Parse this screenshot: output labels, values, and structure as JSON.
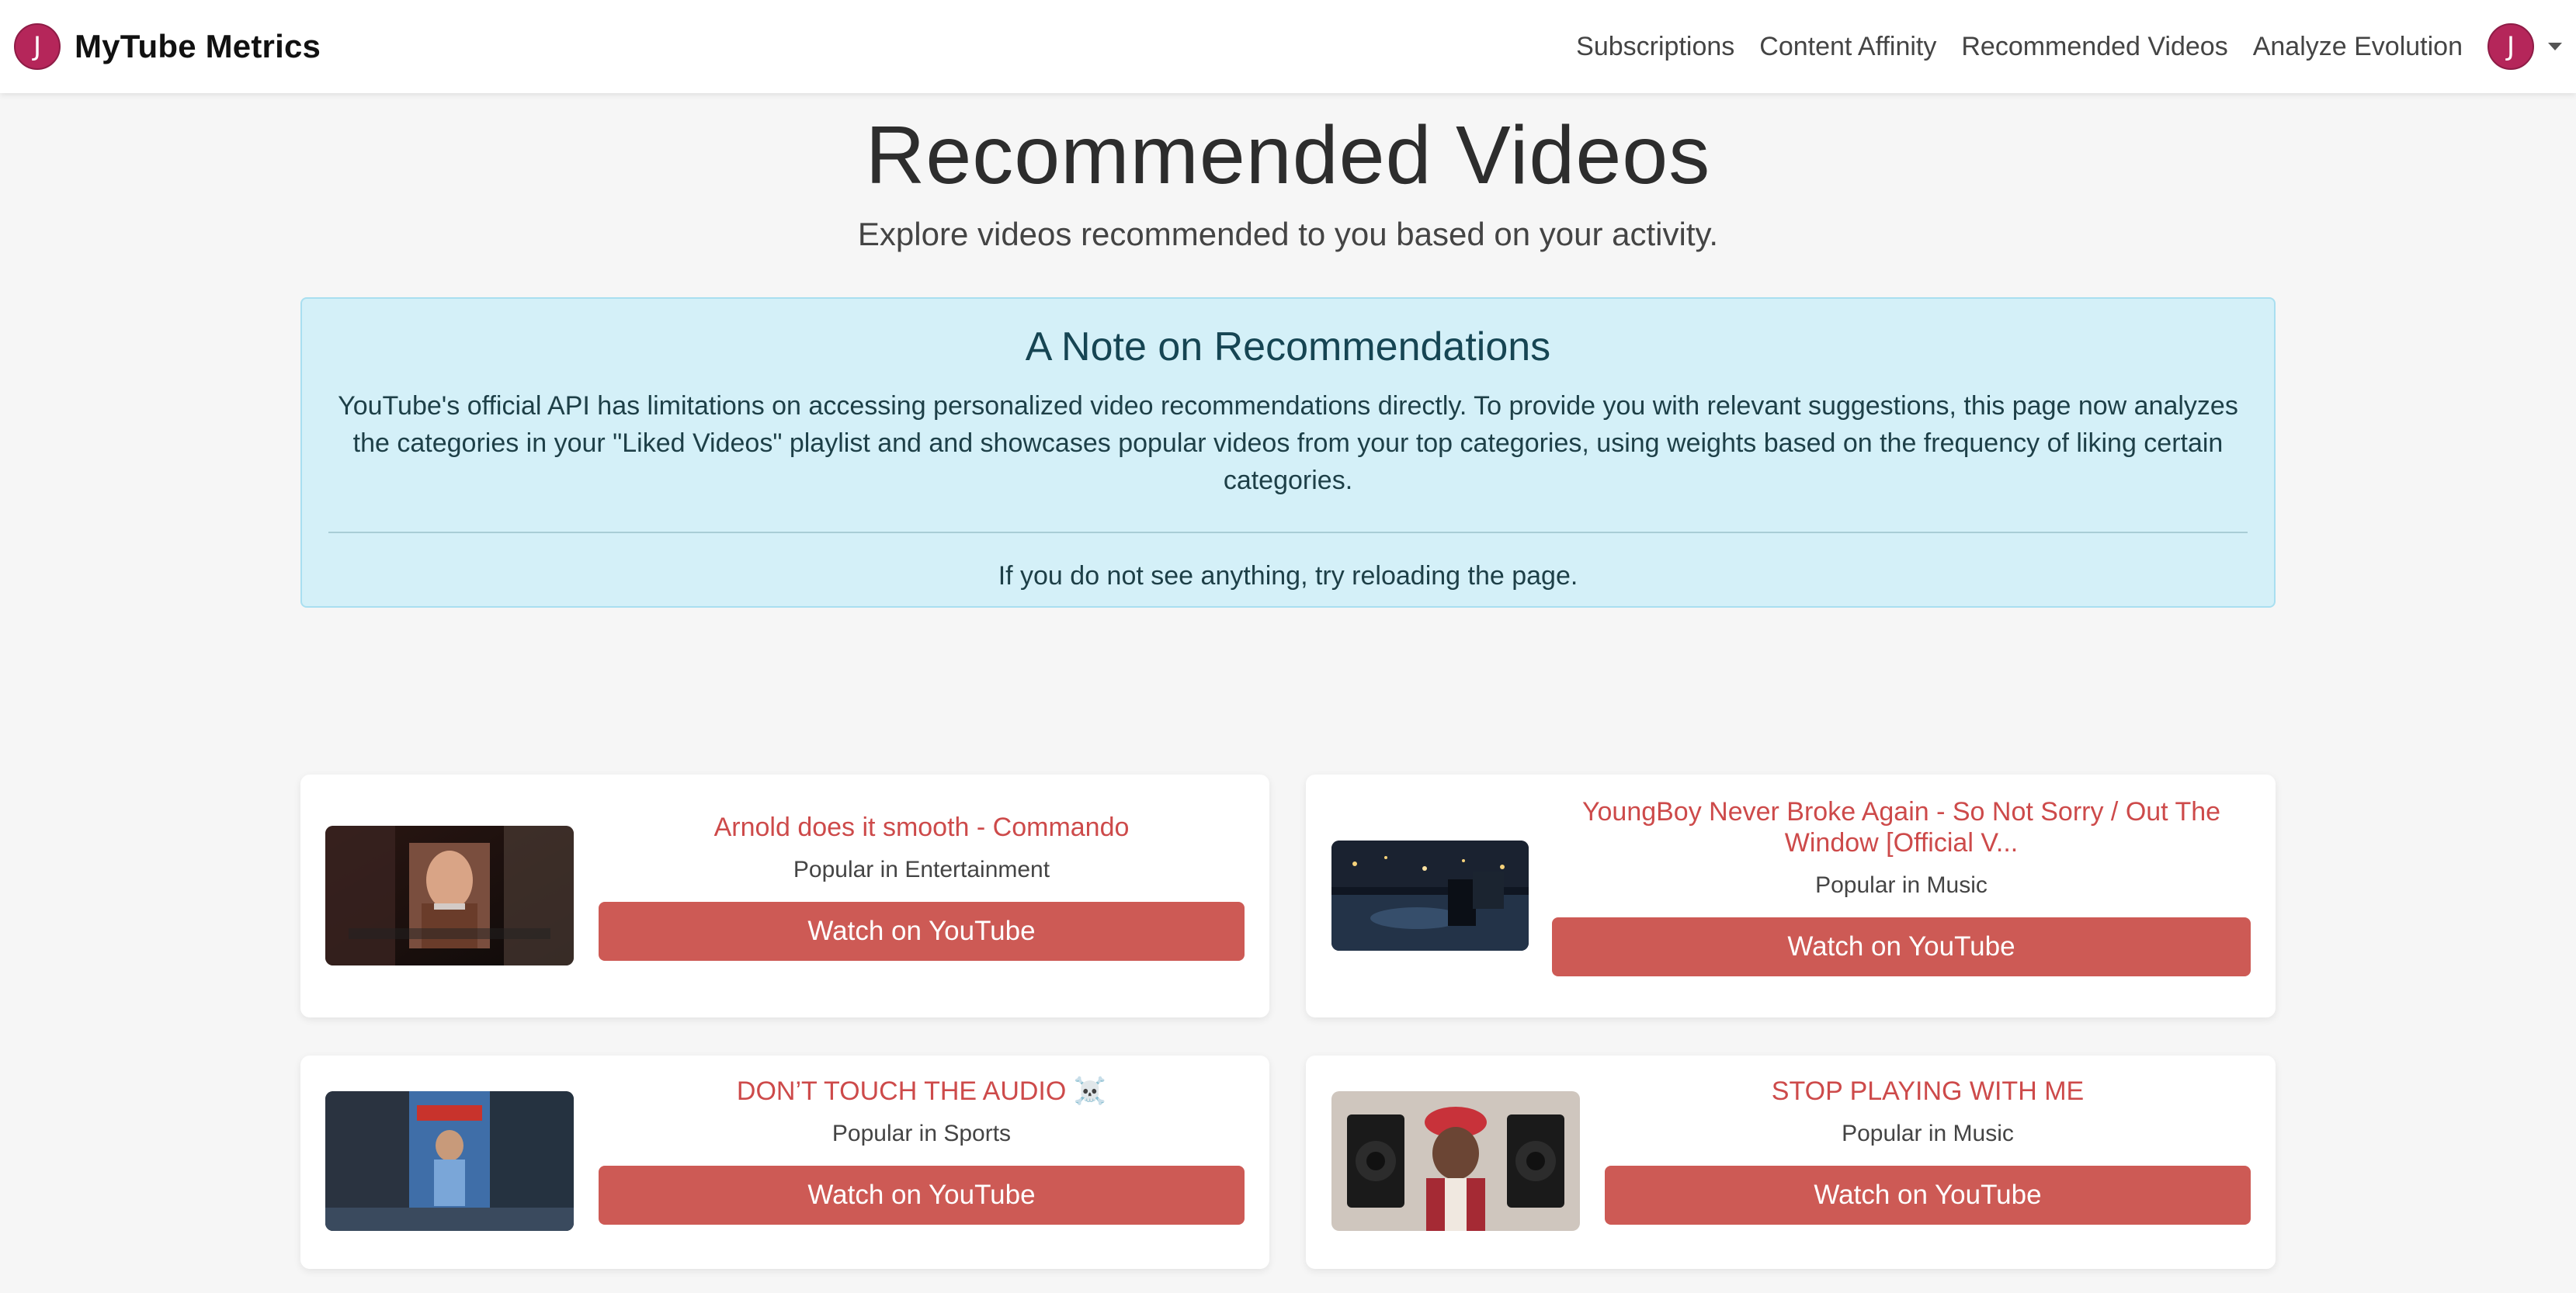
{
  "brand": {
    "avatar_letter": "J",
    "name": "MyTube Metrics"
  },
  "nav": {
    "links": [
      "Subscriptions",
      "Content Affinity",
      "Recommended Videos",
      "Analyze Evolution"
    ],
    "user_avatar_letter": "J"
  },
  "page": {
    "title": "Recommended Videos",
    "subtitle": "Explore videos recommended to you based on your activity."
  },
  "note": {
    "title": "A Note on Recommendations",
    "body": "YouTube's official API has limitations on accessing personalized video recommendations directly. To provide you with relevant suggestions, this page now analyzes the categories in your \"Liked Videos\" playlist and and showcases popular videos from your top categories, using weights based on the frequency of liking certain categories.",
    "footer": "If you do not see anything, try reloading the page."
  },
  "videos": [
    {
      "title": "Arnold does it smooth - Commando",
      "category": "Popular in Entertainment",
      "button": "Watch on YouTube"
    },
    {
      "title": "YoungBoy Never Broke Again - So Not Sorry / Out The Window [Official V...",
      "category": "Popular in Music",
      "button": "Watch on YouTube"
    },
    {
      "title": "DON’T TOUCH THE AUDIO ☠️",
      "category": "Popular in Sports",
      "button": "Watch on YouTube"
    },
    {
      "title": "STOP PLAYING WITH ME",
      "category": "Popular in Music",
      "button": "Watch on YouTube"
    }
  ],
  "colors": {
    "accent": "#cd5a55",
    "title_red": "#cd4a4a",
    "avatar": "#b5265a",
    "note_bg": "#d4f0f8"
  }
}
